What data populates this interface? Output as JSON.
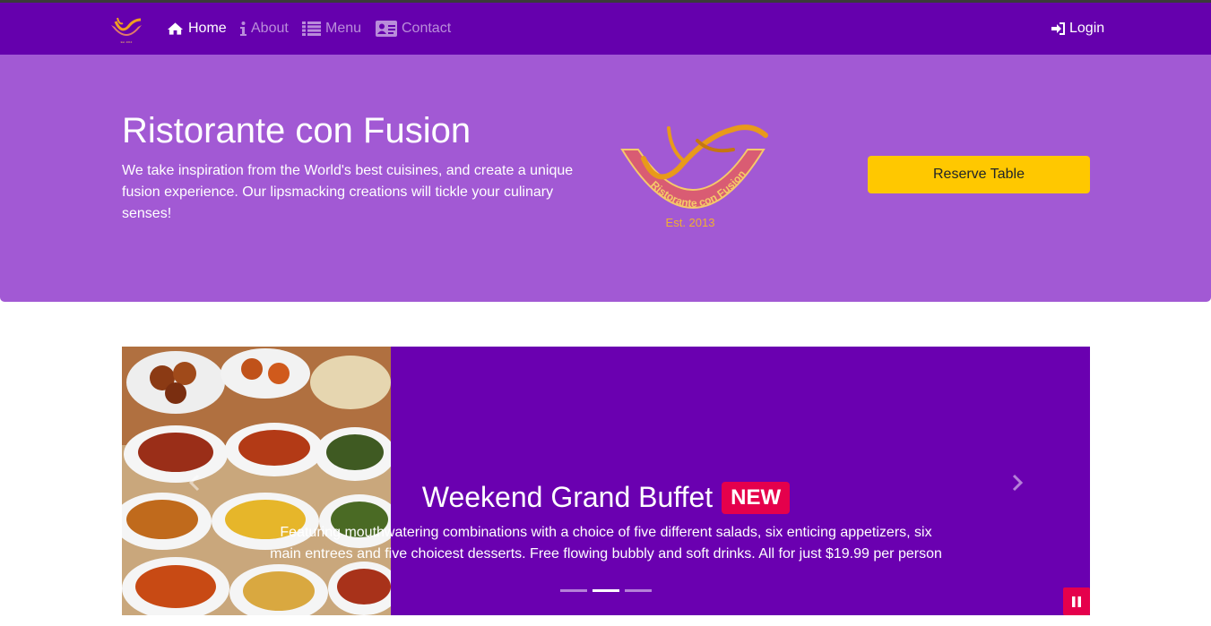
{
  "navbar": {
    "items": [
      {
        "label": "Home",
        "icon": "home-icon",
        "active": true
      },
      {
        "label": "About",
        "icon": "info-icon",
        "active": false
      },
      {
        "label": "Menu",
        "icon": "list-icon",
        "active": false
      },
      {
        "label": "Contact",
        "icon": "address-card-icon",
        "active": false
      }
    ],
    "login_label": "Login"
  },
  "hero": {
    "title": "Ristorante con Fusion",
    "text": "We take inspiration from the World's best cuisines, and create a unique fusion experience. Our lipsmacking creations will tickle your culinary senses!",
    "logo_text": "Ristorante con Fusion",
    "logo_est": "Est. 2013",
    "reserve_label": "Reserve Table"
  },
  "carousel": {
    "title": "Weekend Grand Buffet",
    "badge": "NEW",
    "text": "Featuring mouthwatering combinations with a choice of five different salads, six enticing appetizers, six main entrees and five choicest desserts. Free flowing bubbly and soft drinks. All for just $19.99 per person",
    "indicator_count": 3,
    "active_indicator": 1
  },
  "colors": {
    "navbar": "#6500ad",
    "jumbotron": "#a259d4",
    "carousel": "#6a00b0",
    "accent": "#ffc800",
    "badge": "#e5004c"
  }
}
